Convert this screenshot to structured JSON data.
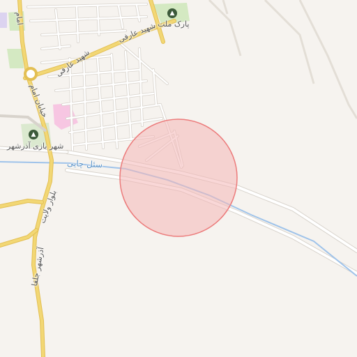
{
  "map": {
    "colors": {
      "background": "#f6f3ef",
      "major_road": "#f2d774",
      "major_road_casing": "#e3bf54",
      "minor_road": "#ffffff",
      "minor_road_casing": "#d8d3cc",
      "river": "#9fc3ea",
      "park": "#d4e9c2",
      "pink_area": "#f7c6e2",
      "circle_fill": "#f4b7b7",
      "circle_stroke": "#ec7b7b"
    },
    "labels": {
      "street_shahid_arefi_1": "شهید عارفی",
      "street_shahid_arefi_2": "شهید عارفی",
      "street_khiaban_imam": "خیابان امام",
      "street_imam": "امام",
      "street_bolvar_velayat": "بلوار ولایت",
      "street_azarshahr_jolfa": "آذرشهر جلفا",
      "river_name": "سئل چایی",
      "poi_park_mellat": "پارک ملت",
      "poi_shahr_bazi": "شهر بازی آذرشهر"
    },
    "icons": {
      "poi_park_mellat": "tree-icon",
      "poi_shahr_bazi": "tree-icon"
    }
  }
}
